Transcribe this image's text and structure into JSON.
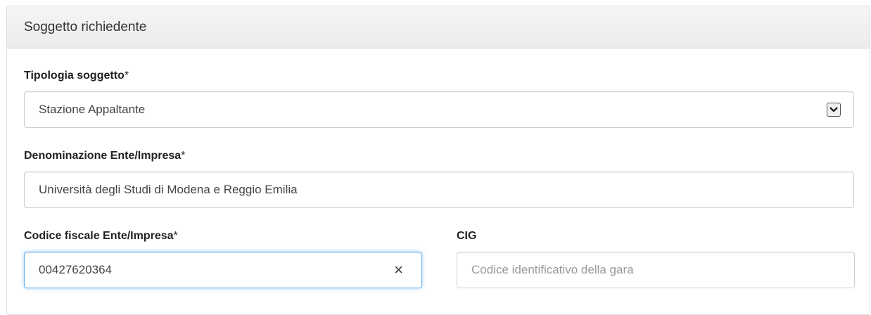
{
  "panel": {
    "title": "Soggetto richiedente"
  },
  "tipologia": {
    "label": "Tipologia soggetto",
    "required_mark": "*",
    "value": "Stazione Appaltante",
    "icon": "chevron-down-icon"
  },
  "denominazione": {
    "label": "Denominazione Ente/Impresa",
    "required_mark": "*",
    "value": "Università degli Studi di Modena e Reggio Emilia"
  },
  "codice_fiscale": {
    "label": "Codice fiscale Ente/Impresa",
    "required_mark": "*",
    "value": "00427620364",
    "clear_icon": "×"
  },
  "cig": {
    "label": "CIG",
    "value": "",
    "placeholder": "Codice identificativo della gara"
  },
  "colors": {
    "focus_border": "#66afe9",
    "border": "#cccccc",
    "heading_bg": "#f5f5f5"
  }
}
